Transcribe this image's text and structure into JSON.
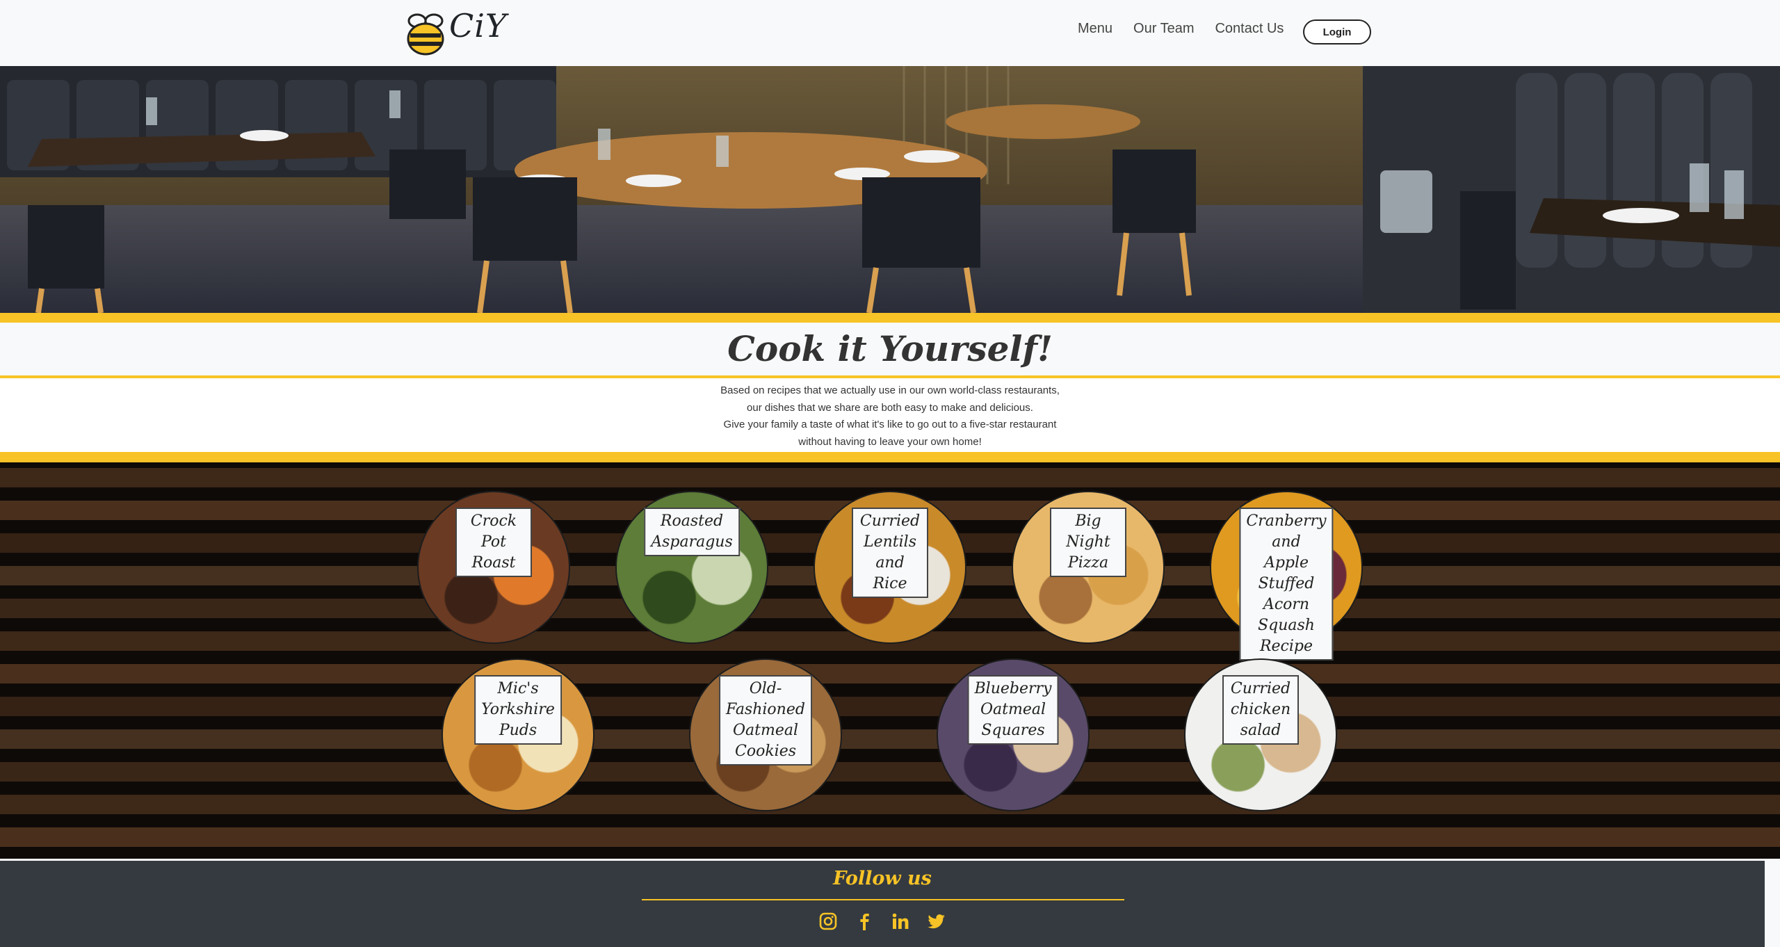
{
  "brand": {
    "name": "CiY"
  },
  "nav": {
    "links": [
      "Menu",
      "Our Team",
      "Contact Us"
    ],
    "login_label": "Login"
  },
  "hero": {
    "title": "Cook it Yourself!"
  },
  "intro": {
    "lines": [
      "Based on recipes that we actually use in our own world-class restaurants,",
      "our dishes that we share are both easy to make and delicious.",
      "Give your family a taste of what it's like to go out to a five-star restaurant",
      "without having to leave your own home!"
    ]
  },
  "recipes": [
    {
      "name": "Crock Pot Roast",
      "colors": [
        "#6b3a22",
        "#e07a2a",
        "#3c2216"
      ]
    },
    {
      "name": "Roasted\nAsparagus",
      "colors": [
        "#5d7d38",
        "#c9d6b0",
        "#2f4a1c"
      ]
    },
    {
      "name": "Curried Lentils\nand Rice",
      "colors": [
        "#c98a2a",
        "#e9e4da",
        "#7a3a18"
      ]
    },
    {
      "name": "Big Night Pizza",
      "colors": [
        "#e8b86a",
        "#d9a04a",
        "#a8703a"
      ]
    },
    {
      "name": "Cranberry and\nApple Stuffed\nAcorn Squash\nRecipe",
      "colors": [
        "#e09a20",
        "#6a2a3a",
        "#f3c040"
      ]
    },
    {
      "name": "Mic's Yorkshire\nPuds",
      "colors": [
        "#d99840",
        "#f2e2b8",
        "#b06a24"
      ]
    },
    {
      "name": "Old-Fashioned\nOatmeal Cookies",
      "colors": [
        "#9a6a3a",
        "#c99a5a",
        "#6a4020"
      ]
    },
    {
      "name": "Blueberry\nOatmeal\nSquares",
      "colors": [
        "#5a4a6a",
        "#d8c0a0",
        "#3a2a4a"
      ]
    },
    {
      "name": "Curried chicken\nsalad",
      "colors": [
        "#f0f0ee",
        "#d8b890",
        "#8aa05a"
      ]
    }
  ],
  "footer": {
    "title": "Follow us",
    "icons": [
      "instagram-icon",
      "facebook-icon",
      "linkedin-icon",
      "twitter-icon"
    ]
  },
  "colors": {
    "accent": "#f7c326",
    "footer_bg": "#343a40",
    "wood": "#3b2618"
  }
}
